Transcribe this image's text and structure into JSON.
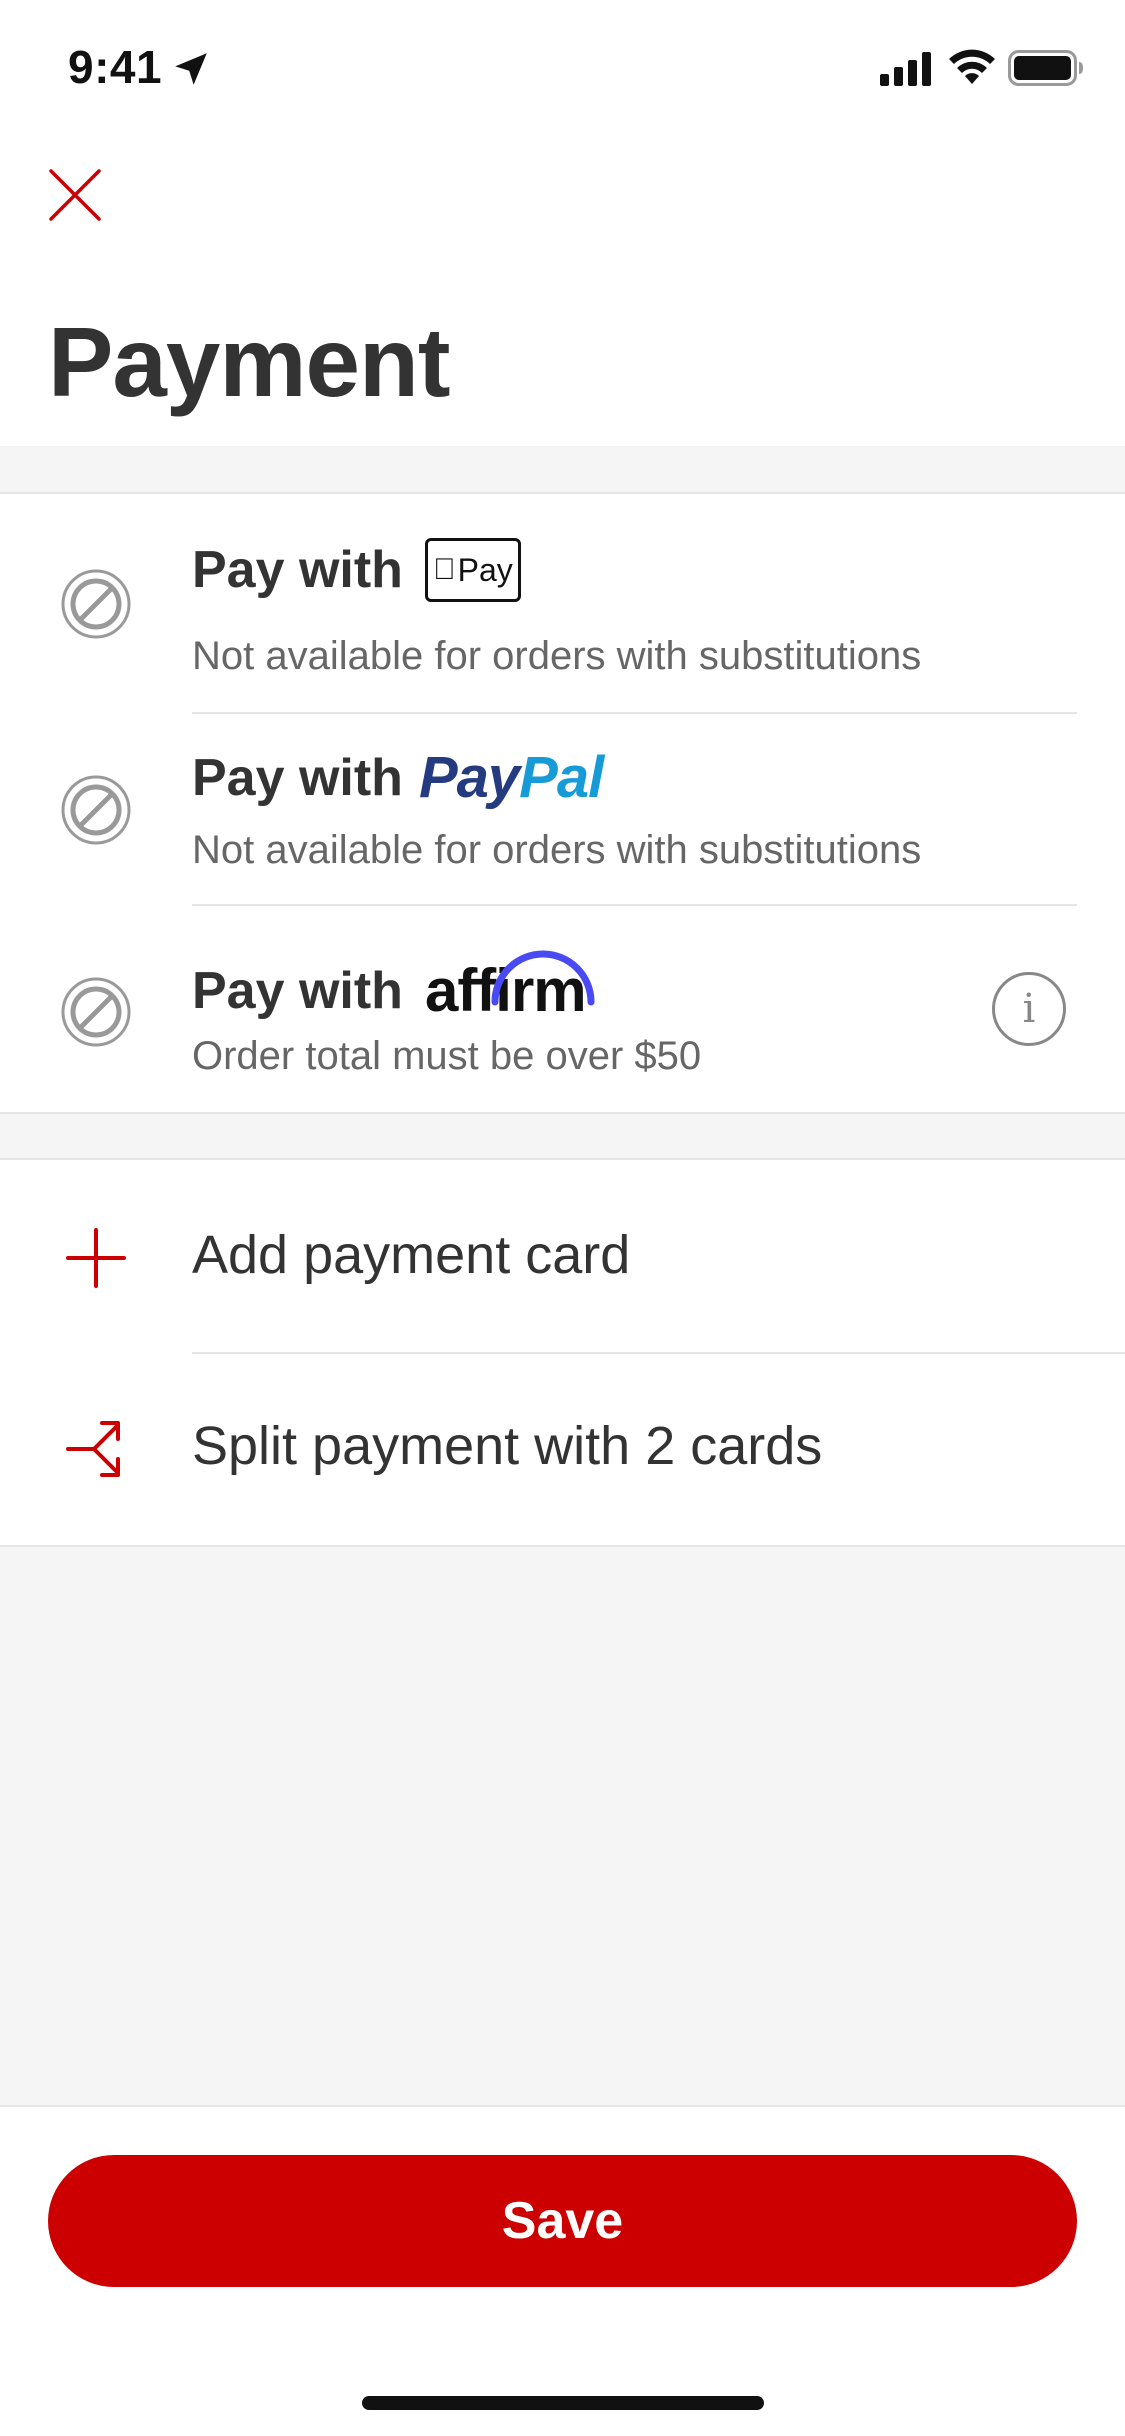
{
  "status_bar": {
    "time": "9:41",
    "icons": [
      "location-arrow-icon",
      "cellular-signal-icon",
      "wifi-icon",
      "battery-icon"
    ]
  },
  "header": {
    "close_icon": "close-icon",
    "title": "Payment"
  },
  "payment_methods": [
    {
      "label": "Pay with",
      "brand": "apple-pay",
      "brand_text": "Pay",
      "subtitle": "Not available for orders with substitutions",
      "available": false
    },
    {
      "label": "Pay with",
      "brand": "paypal",
      "brand_text_1": "Pay",
      "brand_text_2": "Pal",
      "subtitle": "Not available for orders with substitutions",
      "available": false
    },
    {
      "label": "Pay with",
      "brand": "affirm",
      "brand_text": "affirm",
      "subtitle": "Order total must be over $50",
      "available": false,
      "info_icon": "info-icon",
      "info_glyph": "i"
    }
  ],
  "actions": [
    {
      "label": "Add payment card",
      "icon": "plus-icon"
    },
    {
      "label": "Split payment with 2 cards",
      "icon": "split-arrow-icon"
    }
  ],
  "footer": {
    "save_label": "Save"
  },
  "colors": {
    "accent": "#cc0000",
    "text": "#333333",
    "subtext": "#666666",
    "divider": "#e6e6e6",
    "background_grey": "#f5f5f5",
    "paypal_dark": "#253b80",
    "paypal_light": "#179bd7",
    "affirm_arc": "#4a4af4"
  }
}
